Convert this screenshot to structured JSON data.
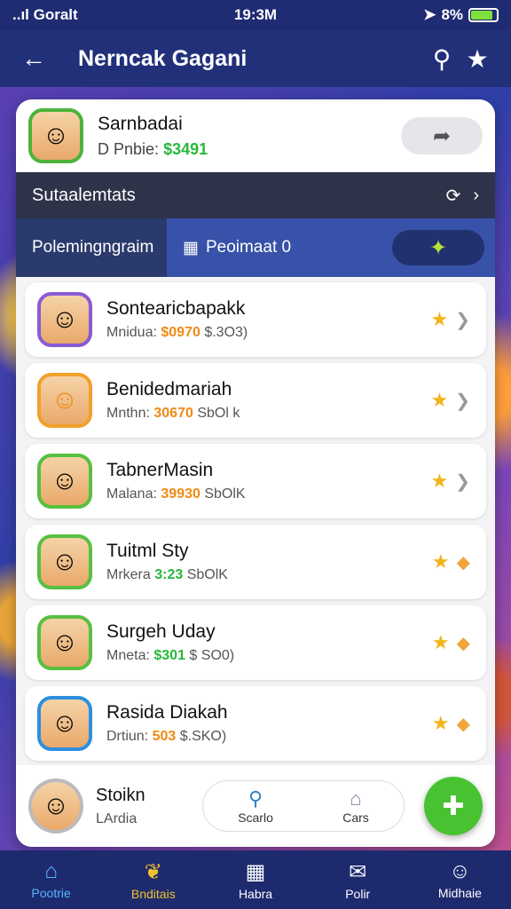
{
  "status_bar": {
    "carrier": "..ıl Goralt",
    "time": "19:3M",
    "battery": "8%"
  },
  "header": {
    "title": "Nerncak Gagani"
  },
  "profile": {
    "name": "Sarnbadai",
    "sub_label": "D Pnbie:",
    "sub_value": "$3491"
  },
  "section": {
    "label": "Sutaalemtats"
  },
  "tabs": {
    "left": "Polemingngraim",
    "right": "Peoimaat 0"
  },
  "rows": [
    {
      "name": "Sontearicbapakk",
      "sub_label": "Mnidua:",
      "value": "$0970",
      "extra": "$.3O3)"
    },
    {
      "name": "Benidedmariah",
      "sub_label": "Mnthn:",
      "value": "30670",
      "extra": "SbOl k"
    },
    {
      "name": "TabnerMasin",
      "sub_label": "Malana:",
      "value": "39930",
      "extra": "SbOlK"
    },
    {
      "name": "Tuitml Sty",
      "sub_label": "Mrkera",
      "value": "3:23",
      "extra": "SbOlK"
    },
    {
      "name": "Surgeh Uday",
      "sub_label": "Mneta:",
      "value": "$301",
      "extra": "$ SO0)"
    },
    {
      "name": "Rasida Diakah",
      "sub_label": "Drtiun:",
      "value": "503",
      "extra": "$.SKO)"
    }
  ],
  "bottom_card": {
    "name": "Stoikn",
    "sub": "LArdia",
    "search_label": "Scarlo",
    "cars_label": "Cars"
  },
  "nav": [
    {
      "label": "Pootrie"
    },
    {
      "label": "Bnditais"
    },
    {
      "label": "Habra"
    },
    {
      "label": "Polir"
    },
    {
      "label": "Midhaie"
    }
  ]
}
